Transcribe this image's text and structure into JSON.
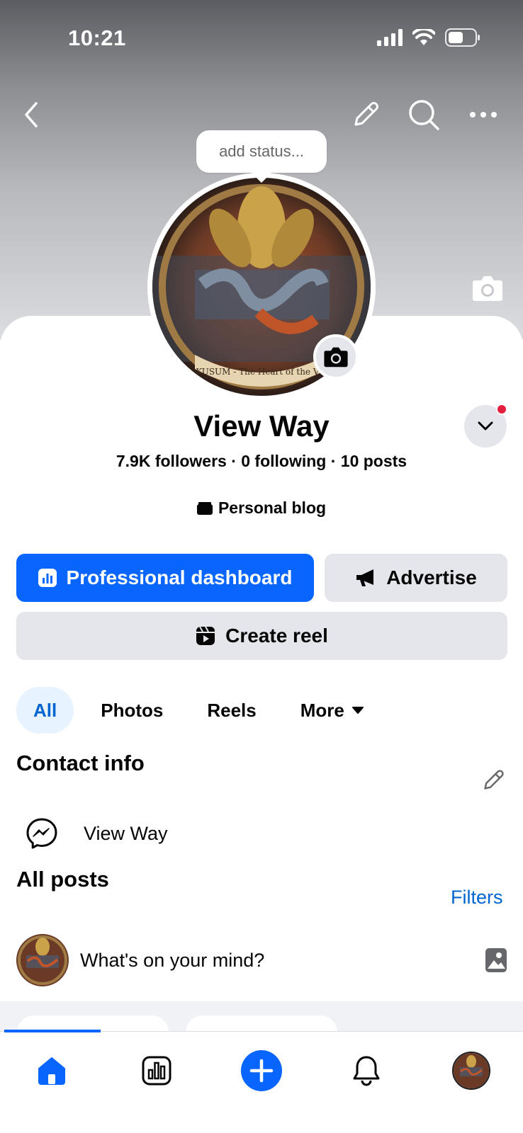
{
  "status_bar": {
    "time": "10:21"
  },
  "top_bar": {
    "back_icon": "chevron-left-icon",
    "edit_icon": "pencil-icon",
    "search_icon": "search-icon",
    "more_icon": "more-horizontal-icon"
  },
  "profile": {
    "status_placeholder": "add status...",
    "name": "View Way",
    "avatar_text": "KUSUM - The Heart of the Vill",
    "stats": "7.9K followers · 0 following · 10 posts",
    "category": "Personal blog"
  },
  "actions": {
    "professional_dashboard": "Professional dashboard",
    "advertise": "Advertise",
    "create_reel": "Create reel"
  },
  "tabs": {
    "all": "All",
    "photos": "Photos",
    "reels": "Reels",
    "more": "More"
  },
  "contact_info": {
    "title": "Contact info",
    "messenger_name": "View Way"
  },
  "posts": {
    "title": "All posts",
    "filters": "Filters",
    "composer_placeholder": "What's on your mind?"
  },
  "colors": {
    "accent": "#0866ff",
    "link": "#0064d1",
    "button_gray": "#e4e6eb",
    "notification": "#e41e3f"
  }
}
